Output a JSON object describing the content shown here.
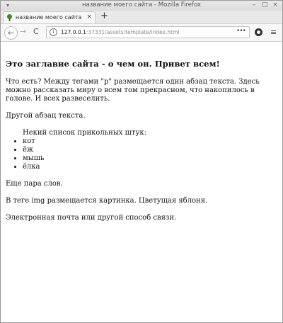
{
  "window": {
    "title": "название моего сайта - Mozilla Firefox",
    "menu_glyph": "▾",
    "buttons": {
      "minimize": "–",
      "maximize": "□",
      "close": "×"
    }
  },
  "tab": {
    "title": "название моего сайта",
    "close": "×",
    "new_tab": "+"
  },
  "nav": {
    "back": "←",
    "forward": "→",
    "reload": "C",
    "url_host": "127.0.0.1",
    "url_path": ":37331/assets/template/index.html",
    "url_more": "•••",
    "menu": "≡"
  },
  "page": {
    "heading": "Это заглавие сайта - о чем он. Привет всем!",
    "para1": "Что есть? Между тегами \"p\" размещается один абзац текста. Здесь можно рассказать миру о всем том прекрасном, что накопилось в голове. И всех развеселить.",
    "para2": "Другой абзац текста.",
    "list_intro": "Некий список прикольных штук:",
    "list_items": [
      "кот",
      "ёж",
      "мышь",
      "ёлка"
    ],
    "para3": "Еще пара слов.",
    "para4": "В теге img размещается картинка. Цветущая яблоня.",
    "para5": "Электронная почта или другой способ связи."
  }
}
